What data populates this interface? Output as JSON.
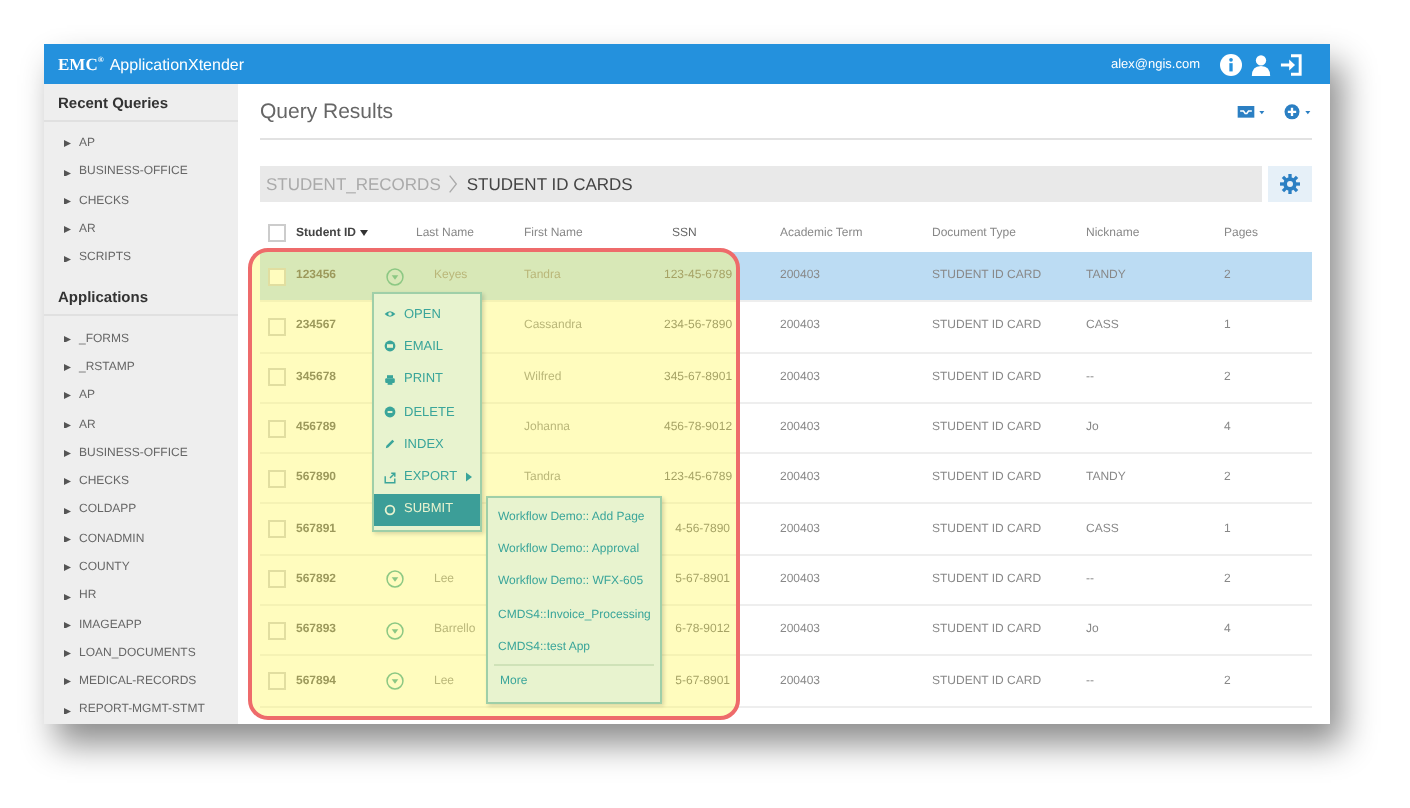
{
  "header": {
    "logo": "EMC$^{®}$",
    "app_name": "ApplicationXtender",
    "user": "alex@ngis.com"
  },
  "sidebar": {
    "sections": [
      {
        "title": "Recent Queries",
        "items": [
          "AP",
          "BUSINESS-OFFICE",
          "CHECKS",
          "AR",
          "SCRIPTS"
        ]
      },
      {
        "title": "Applications",
        "items": [
          "_FORMS",
          "_RSTAMP",
          "AP",
          "AR",
          "BUSINESS-OFFICE",
          "CHECKS",
          "COLDAPP",
          "CONADMIN",
          "COUNTY",
          "HR",
          "IMAGEAPP",
          "LOAN_DOCUMENTS",
          "MEDICAL-RECORDS",
          "REPORT-MGMT-STMT"
        ]
      }
    ]
  },
  "page_title": "Query Results",
  "breadcrumb": [
    "STUDENT_RECORDS",
    "STUDENT ID CARDS"
  ],
  "table": {
    "select_all_checked": false,
    "columns": [
      {
        "label": "Student ID",
        "sorted": true
      },
      {
        "label": "Last Name",
        "sorted": false
      },
      {
        "label": "First Name",
        "sorted": false
      },
      {
        "label": "SSN",
        "sorted": false
      },
      {
        "label": "Academic Term",
        "sorted": false
      },
      {
        "label": "Document Type",
        "sorted": false
      },
      {
        "label": "Nickname",
        "sorted": false
      },
      {
        "label": "Pages",
        "sorted": false
      }
    ],
    "rows": [
      {
        "student_id": "123456",
        "action_button": true,
        "last_name": "Keyes",
        "first_name": "Tandra",
        "ssn": "123-45-6789",
        "term": "200403",
        "doc_type": "STUDENT ID CARD",
        "nickname": "TANDY",
        "pages": "2",
        "selected": true
      },
      {
        "student_id": "234567",
        "action_button": false,
        "first_name": "Cassandra",
        "ssn": "234-56-7890",
        "term": "200403",
        "doc_type": "STUDENT ID CARD",
        "nickname": "CASS",
        "pages": "1",
        "selected": false
      },
      {
        "student_id": "345678",
        "action_button": false,
        "first_name": "Wilfred",
        "ssn": "345-67-8901",
        "term": "200403",
        "doc_type": "STUDENT ID CARD",
        "nickname": "--",
        "pages": "2",
        "selected": false
      },
      {
        "student_id": "456789",
        "action_button": false,
        "first_name": "Johanna",
        "ssn": "456-78-9012",
        "term": "200403",
        "doc_type": "STUDENT ID CARD",
        "nickname": "Jo",
        "pages": "4",
        "selected": false
      },
      {
        "student_id": "567890",
        "action_button": false,
        "first_name": "Tandra",
        "ssn": "123-45-6789",
        "term": "200403",
        "doc_type": "STUDENT ID CARD",
        "nickname": "TANDY",
        "pages": "2",
        "selected": false
      },
      {
        "student_id": "567891",
        "action_button": false,
        "ssn": "4-56-7890",
        "term": "200403",
        "doc_type": "STUDENT ID CARD",
        "nickname": "CASS",
        "pages": "1",
        "selected": false
      },
      {
        "student_id": "567892",
        "action_button": true,
        "last_name": "Lee",
        "ssn": "5-67-8901",
        "term": "200403",
        "doc_type": "STUDENT ID CARD",
        "nickname": "--",
        "pages": "2",
        "selected": false
      },
      {
        "student_id": "567893",
        "action_button": true,
        "last_name": "Barrello",
        "ssn": "6-78-9012",
        "term": "200403",
        "doc_type": "STUDENT ID CARD",
        "nickname": "Jo",
        "pages": "4",
        "selected": false
      },
      {
        "student_id": "567894",
        "action_button": true,
        "last_name": "Lee",
        "ssn": "5-67-8901",
        "term": "200403",
        "doc_type": "STUDENT ID CARD",
        "nickname": "--",
        "pages": "2",
        "selected": false
      }
    ]
  },
  "row_menu": {
    "items": [
      {
        "label": "OPEN",
        "has_submenu": false,
        "selected": false
      },
      {
        "label": "EMAIL",
        "has_submenu": false,
        "selected": false
      },
      {
        "label": "PRINT",
        "has_submenu": false,
        "selected": false
      },
      {
        "label": "DELETE",
        "has_submenu": false,
        "selected": false
      },
      {
        "label": "INDEX",
        "has_submenu": false,
        "selected": false
      },
      {
        "label": "EXPORT",
        "has_submenu": true,
        "selected": false
      },
      {
        "label": "SUBMIT",
        "has_submenu": false,
        "selected": true
      }
    ]
  },
  "submenu": {
    "items": [
      "Workflow Demo:: Add Page",
      "Workflow Demo:: Approval",
      "Workflow Demo:: WFX-605",
      "CMDS4::Invoice_Processing",
      "CMDS4::test App"
    ],
    "more": "More"
  }
}
